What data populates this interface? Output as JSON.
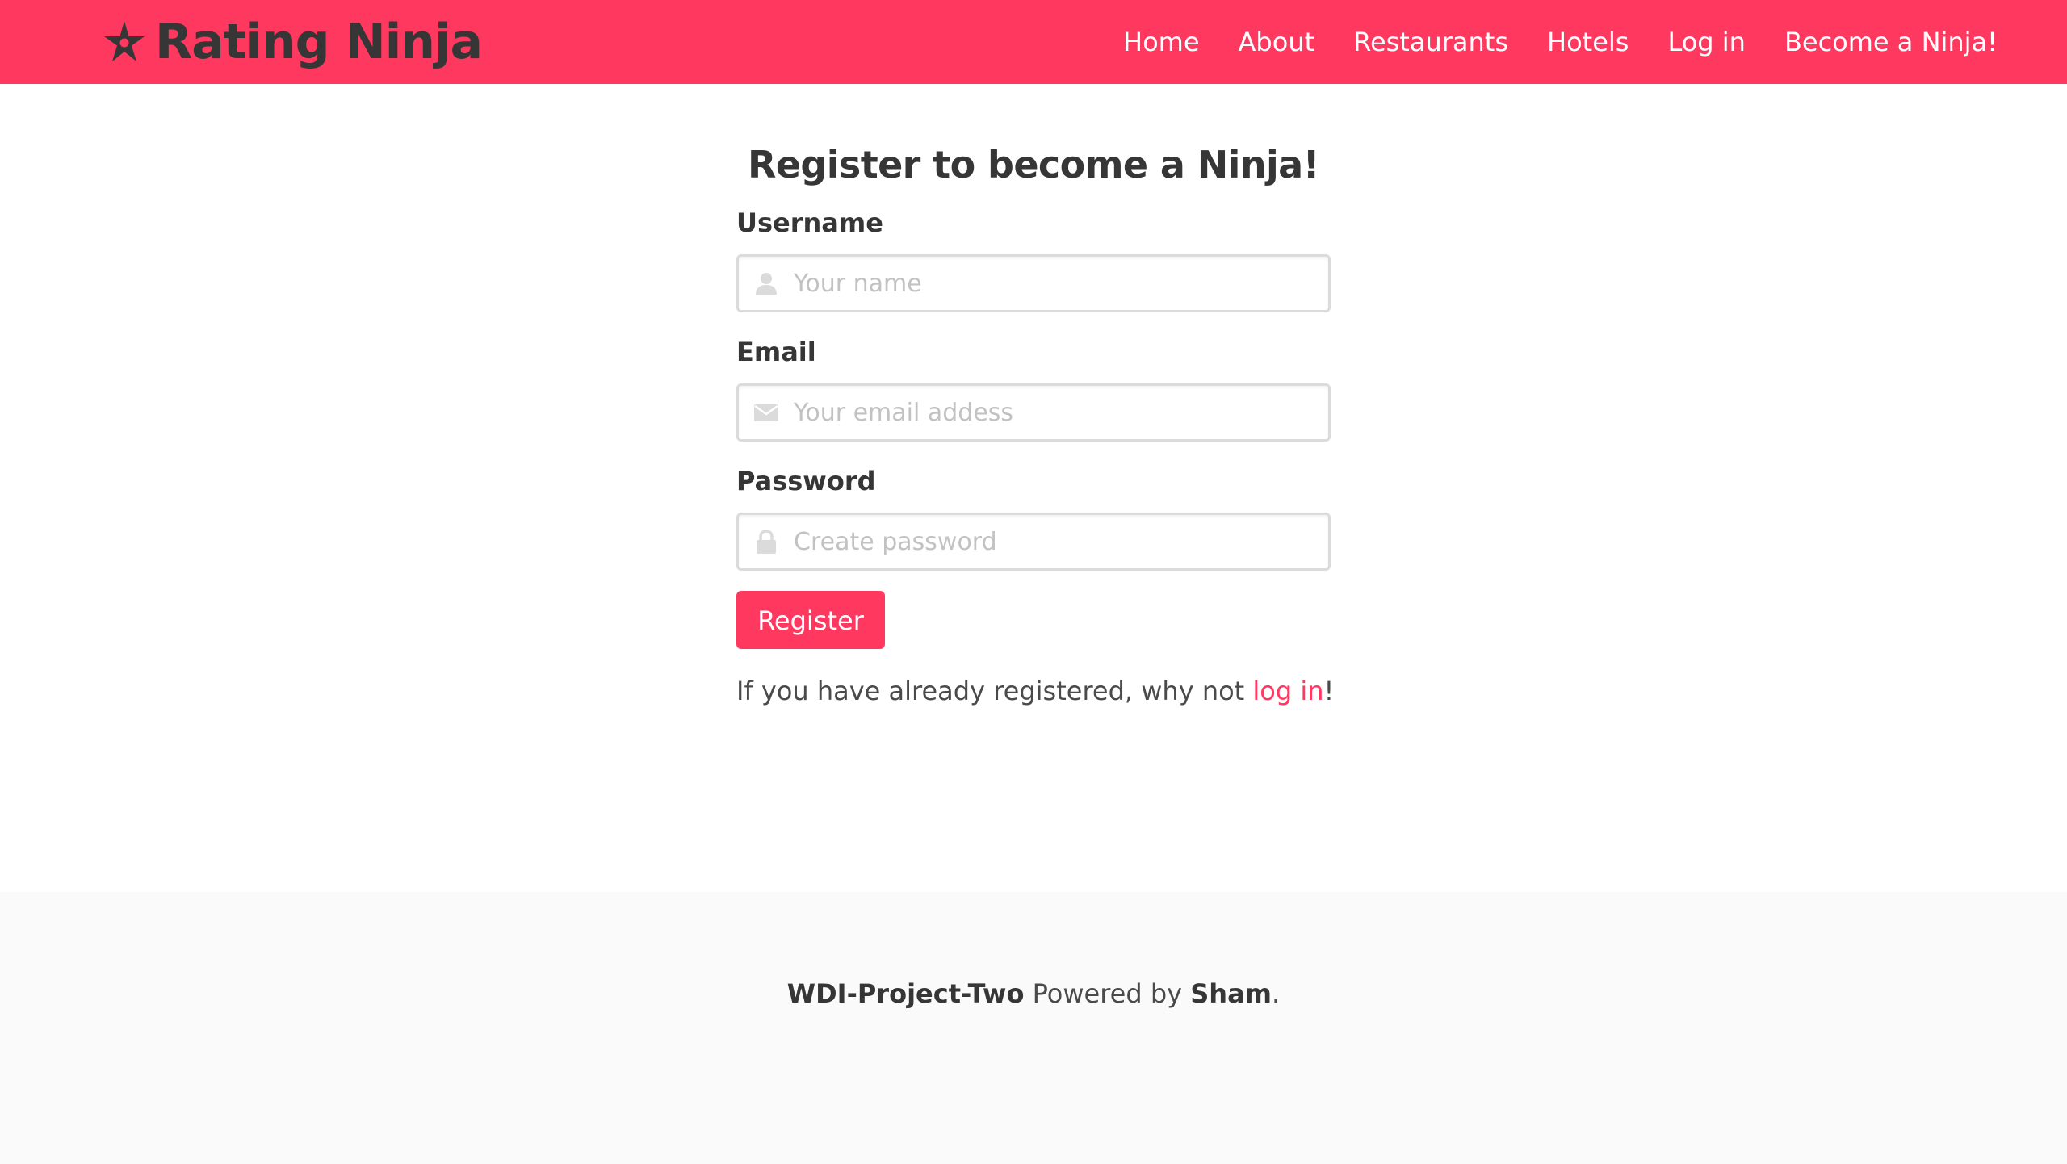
{
  "navbar": {
    "brand_title": "Rating Ninja",
    "brand_icon": "ninja-star-icon",
    "items": [
      {
        "label": "Home"
      },
      {
        "label": "About"
      },
      {
        "label": "Restaurants"
      },
      {
        "label": "Hotels"
      },
      {
        "label": "Log in"
      },
      {
        "label": "Become a Ninja!"
      }
    ]
  },
  "form": {
    "title": "Register to become a Ninja!",
    "username": {
      "label": "Username",
      "placeholder": "Your name",
      "value": "",
      "icon": "user-icon"
    },
    "email": {
      "label": "Email",
      "placeholder": "Your email addess",
      "value": "",
      "icon": "envelope-icon"
    },
    "password": {
      "label": "Password",
      "placeholder": "Create password",
      "value": "",
      "icon": "lock-icon"
    },
    "submit_label": "Register",
    "login_note_prefix": "If you have already registered, why not ",
    "login_link_label": "log in",
    "login_note_suffix": "!"
  },
  "footer": {
    "project_name": "WDI-Project-Two",
    "powered_by": " Powered by ",
    "author": "Sham",
    "end": "."
  },
  "colors": {
    "brand": "#ff3860",
    "text_dark": "#363636",
    "text": "#4a4a4a",
    "placeholder": "#c2c2c2",
    "border": "#dbdbdb",
    "footer_bg": "#fafafa"
  }
}
